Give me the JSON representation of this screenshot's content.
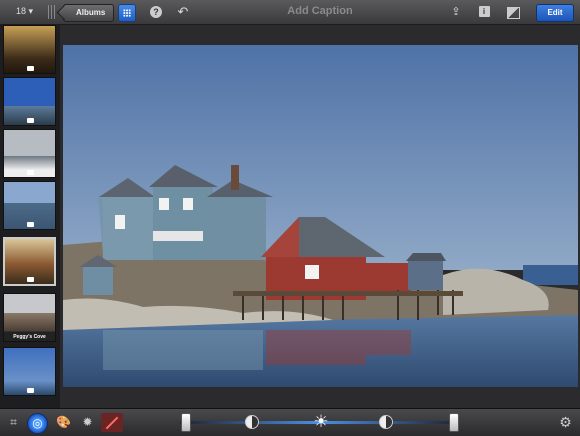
{
  "header": {
    "photo_count": "18 ▾",
    "back_label": "Albums",
    "caption_placeholder": "Add Caption",
    "edit_label": "Edit"
  },
  "sidebar": {
    "thumbnails": [
      {
        "label": ""
      },
      {
        "label": ""
      },
      {
        "label": ""
      },
      {
        "label": ""
      },
      {
        "label": ""
      },
      {
        "label": "Peggy's Cove"
      },
      {
        "label": ""
      }
    ]
  },
  "colors": {
    "accent": "#2e6fd6",
    "sky": "#5d7fb0",
    "water": "#4b6f9e",
    "house_teal": "#6f93a8",
    "house_red": "#9c3a32"
  },
  "icons": {
    "grid": "grid-icon",
    "help": "question-icon",
    "undo": "undo-icon",
    "share": "share-icon",
    "info": "info-icon",
    "compare": "compare-icon",
    "crop": "crop-icon",
    "adjust": "exposure-icon",
    "brush": "brushes-icon",
    "effects": "effects-icon",
    "repair": "repair-icon",
    "sun": "sun-icon",
    "settings": "gear-icon"
  }
}
